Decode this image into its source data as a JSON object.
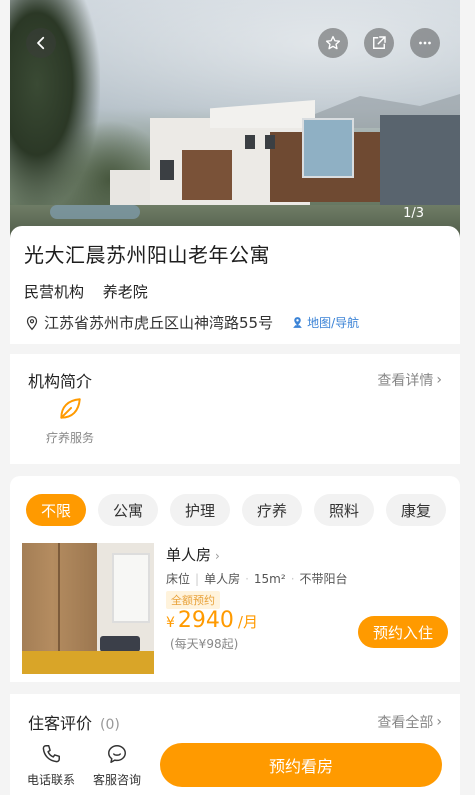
{
  "hero": {
    "image_counter": "1/3",
    "buttons": [
      "back-icon",
      "star-icon",
      "share-icon",
      "more-icon"
    ]
  },
  "institution": {
    "name": "光大汇晨苏州阳山老年公寓",
    "tags": [
      "民营机构",
      "养老院"
    ],
    "address": "江苏省苏州市虎丘区山神湾路55号",
    "map_link": "地图/导航"
  },
  "intro": {
    "title": "机构简介",
    "more": "查看详情",
    "services": [
      {
        "label": "疗养服务",
        "icon": "leaf-icon"
      }
    ]
  },
  "rooms": {
    "filters": [
      "不限",
      "公寓",
      "护理",
      "疗养",
      "照料",
      "康复"
    ],
    "active_filter": "不限",
    "items": [
      {
        "name": "单人房",
        "meta": [
          "床位",
          "单人房",
          "15m²",
          "不带阳台"
        ],
        "badge": "全额预约",
        "currency": "¥",
        "price": "2940",
        "unit": "/月",
        "daily": "(每天¥98起)",
        "action": "预约入住"
      }
    ]
  },
  "reviews": {
    "title": "住客评价",
    "count": "(0)",
    "more": "查看全部"
  },
  "bottom_bar": {
    "phone": "电话联系",
    "service": "客服咨询",
    "main_action": "预约看房"
  },
  "colors": {
    "accent": "#ff9a00",
    "link": "#3b83d6"
  }
}
